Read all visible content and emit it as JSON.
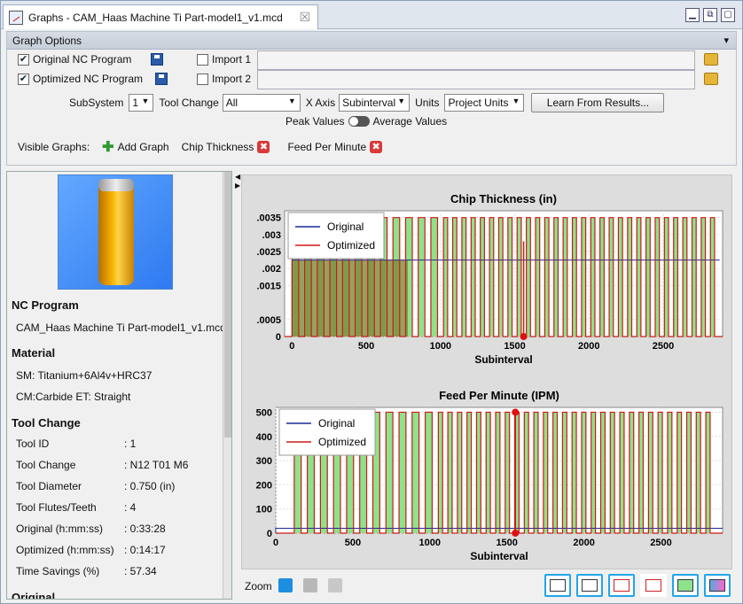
{
  "window": {
    "tab_title": "Graphs - CAM_Haas Machine Ti Part-model1_v1.mcd",
    "close_glyph": "☒",
    "controls": [
      "▁",
      "⧉",
      "▢"
    ]
  },
  "graph_options": {
    "header": "Graph Options",
    "original_label": "Original NC Program",
    "optimized_label": "Optimized NC Program",
    "original_checked": true,
    "optimized_checked": true,
    "import1_label": "Import 1",
    "import2_label": "Import 2",
    "import1_path": "",
    "import2_path": "",
    "subsystem_label": "SubSystem",
    "subsystem_value": "1",
    "tool_change_label": "Tool Change",
    "tool_change_value": "All",
    "xaxis_label": "X Axis",
    "xaxis_value": "Subinterval",
    "units_label": "Units",
    "units_value": "Project Units",
    "learn_button": "Learn From Results...",
    "peak_label": "Peak Values",
    "average_label": "Average Values",
    "visible_graphs_label": "Visible Graphs:",
    "add_graph_label": "Add Graph",
    "visible_graphs": [
      "Chip Thickness",
      "Feed Per Minute"
    ]
  },
  "info": {
    "nc_program_heading": "NC Program",
    "nc_program_value": "CAM_Haas Machine Ti Part-model1_v1.mcd",
    "material_heading": "Material",
    "material_sm": "SM: Titanium+6Al4v+HRC37",
    "material_cm": "CM:Carbide ET: Straight",
    "tool_change_heading": "Tool Change",
    "rows": [
      {
        "key": "Tool ID",
        "value": ": 1"
      },
      {
        "key": "Tool Change",
        "value": ": N12 T01 M6"
      },
      {
        "key": "Tool Diameter",
        "value": ": 0.750 (in)"
      },
      {
        "key": "Tool Flutes/Teeth",
        "value": ": 4"
      },
      {
        "key": "Original (h:mm:ss)",
        "value": ": 0:33:28"
      },
      {
        "key": "Optimized (h:mm:ss)",
        "value": ": 0:14:17"
      },
      {
        "key": "Time Savings (%)",
        "value": ": 57.34"
      }
    ],
    "next_heading": "Original"
  },
  "bottom": {
    "zoom_label": "Zoom"
  },
  "chart_data": [
    {
      "type": "line",
      "title": "Chip Thickness (in)",
      "xlabel": "Subinterval",
      "ylabel": "",
      "xlim": [
        -50,
        2900
      ],
      "ylim": [
        0,
        0.0037
      ],
      "xticks": [
        0,
        500,
        1000,
        1500,
        2000,
        2500
      ],
      "yticks": [
        "0",
        ".0005",
        ".0015",
        ".002",
        ".0025",
        ".003",
        ".0035"
      ],
      "ytick_values": [
        0,
        0.0005,
        0.0015,
        0.002,
        0.0025,
        0.003,
        0.0035
      ],
      "legend": "top-left",
      "series": [
        {
          "name": "Original",
          "color": "#1a2a9a",
          "on_level": 0.00225
        },
        {
          "name": "Optimized",
          "color": "#d01818",
          "on_level": 0.0035
        }
      ],
      "fill_color": "#8ee28a",
      "original_fill_color": "#7c8a38"
    },
    {
      "type": "line",
      "title": "Feed Per Minute (IPM)",
      "xlabel": "Subinterval",
      "ylabel": "",
      "xlim": [
        0,
        2900
      ],
      "ylim": [
        0,
        520
      ],
      "xticks": [
        0,
        500,
        1000,
        1500,
        2000,
        2500
      ],
      "yticks": [
        "0",
        "100",
        "200",
        "300",
        "400",
        "500"
      ],
      "ytick_values": [
        0,
        100,
        200,
        300,
        400,
        500
      ],
      "legend": "top-left",
      "series": [
        {
          "name": "Original",
          "color": "#1a2a9a",
          "on_level": 20
        },
        {
          "name": "Optimized",
          "color": "#d01818",
          "on_level": 500
        }
      ],
      "fill_color": "#8ee28a",
      "marker_x": 1555
    }
  ]
}
